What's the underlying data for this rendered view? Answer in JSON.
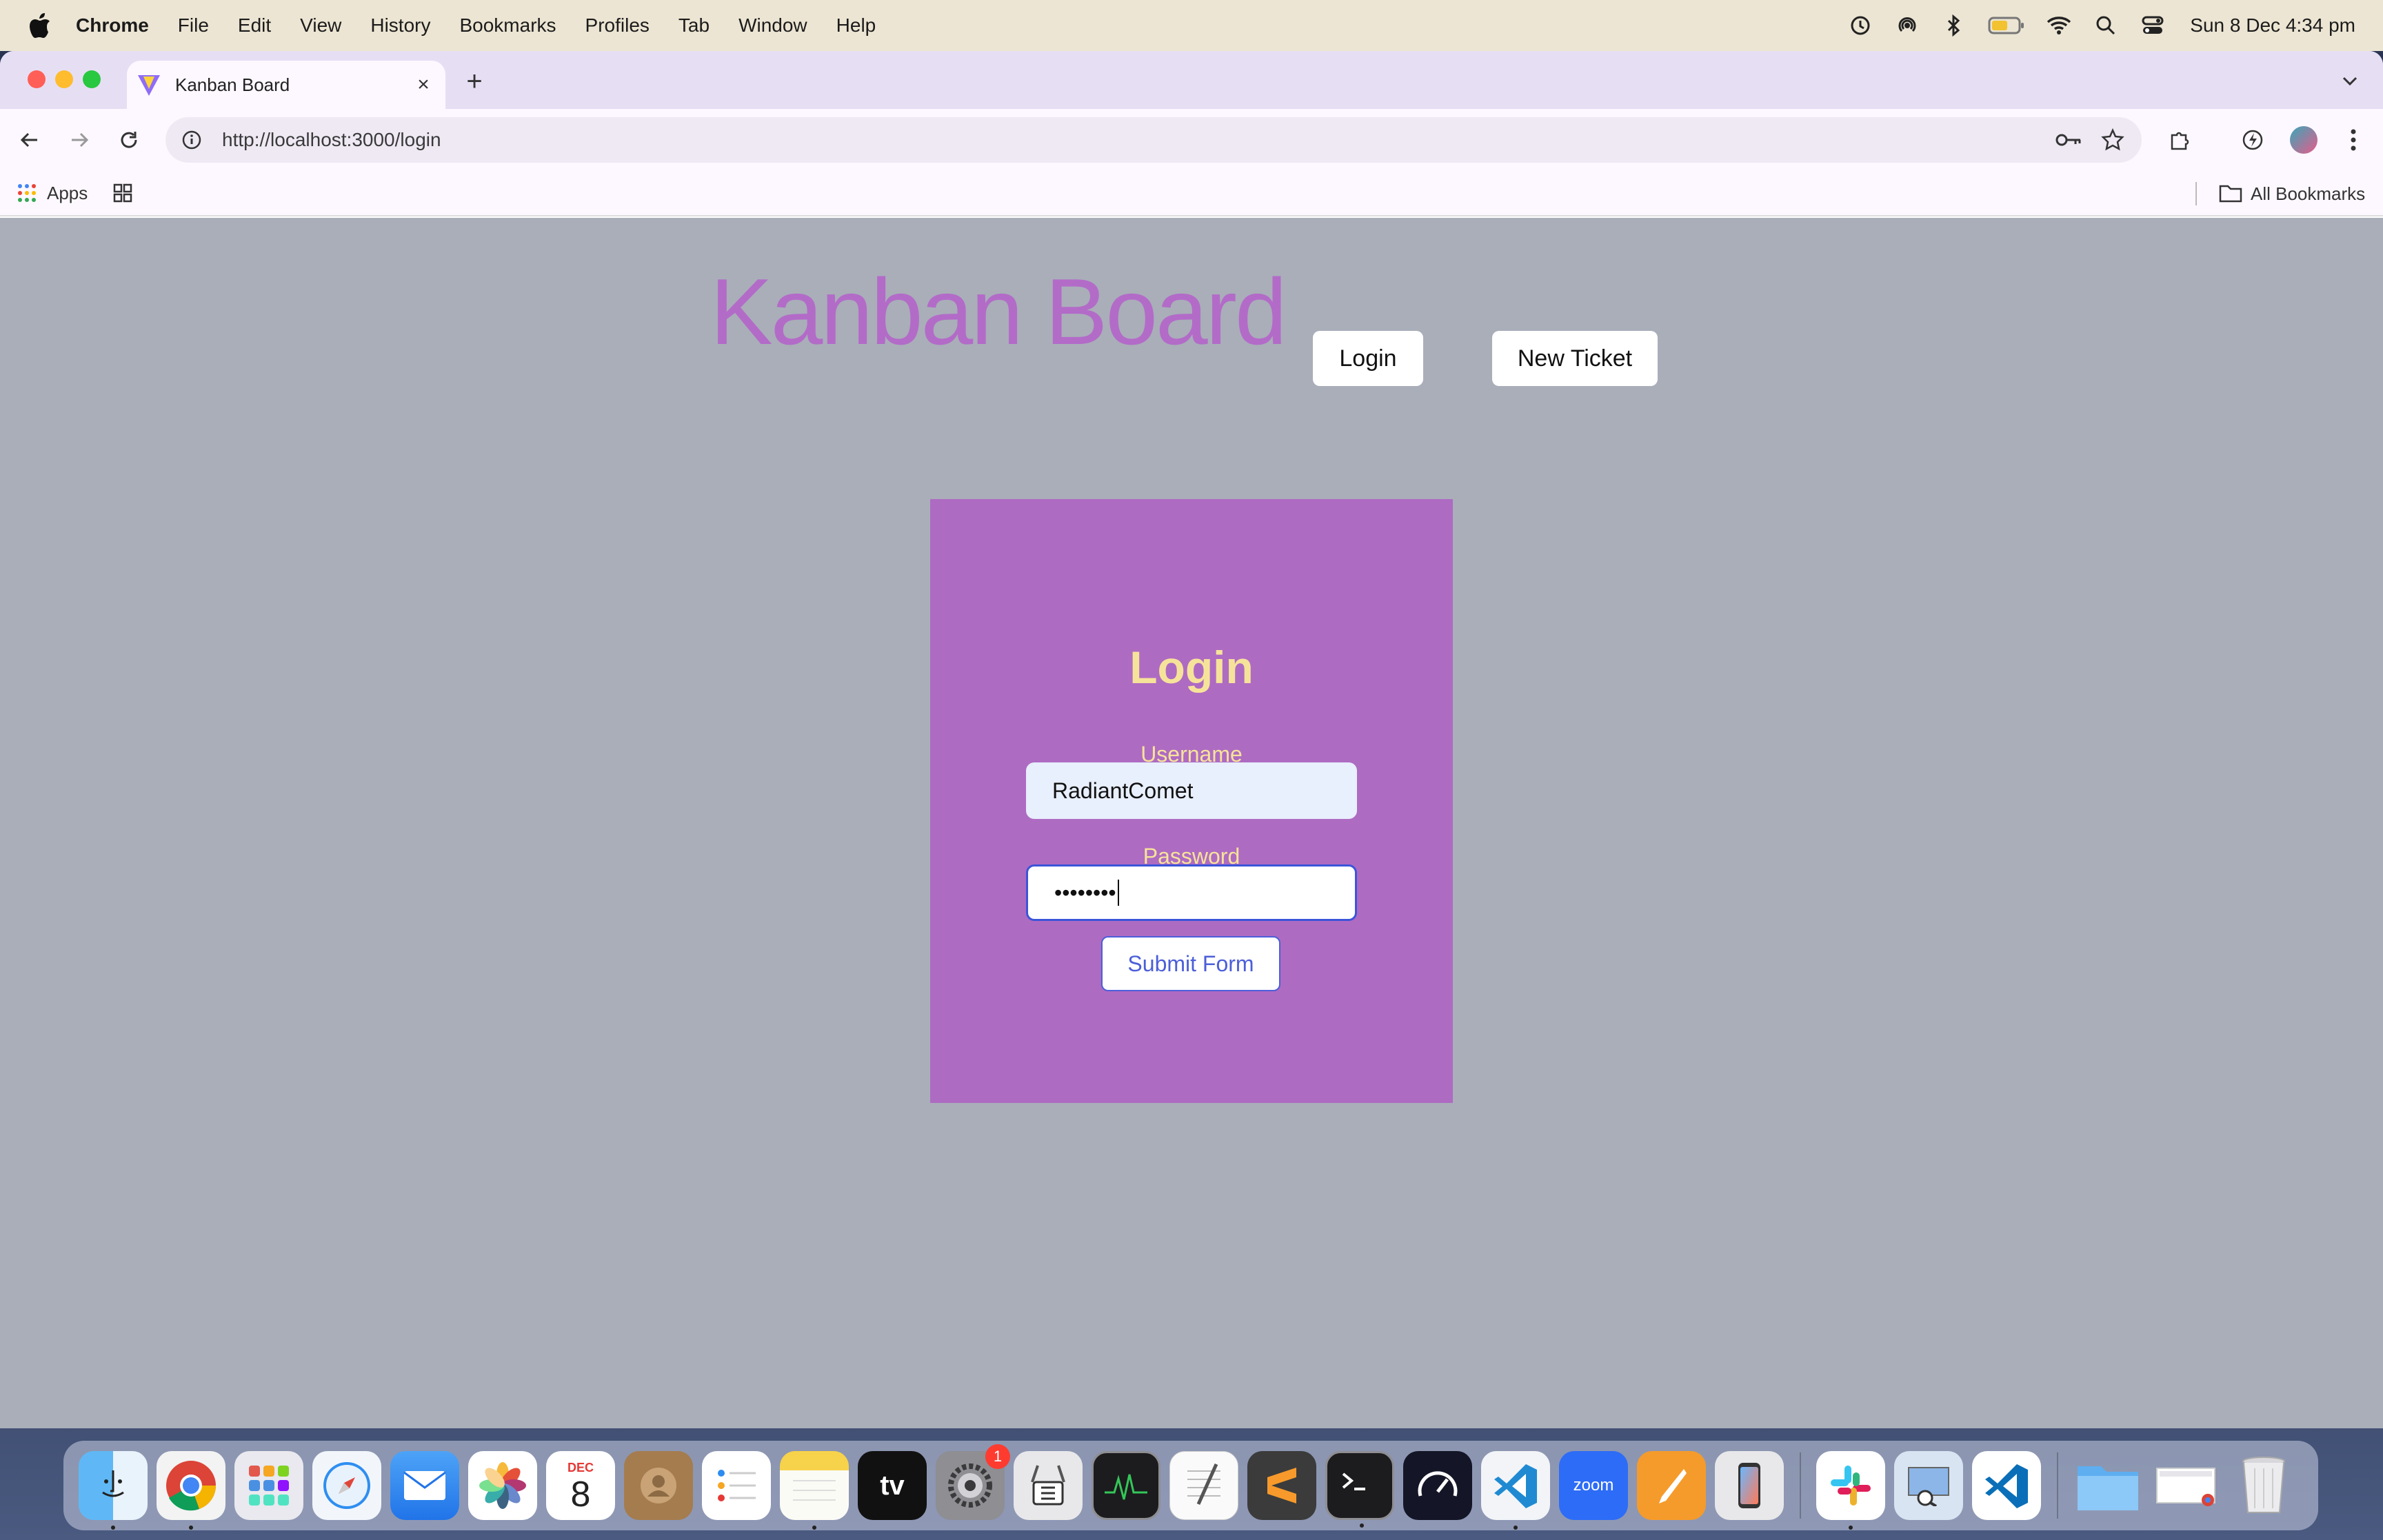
{
  "menubar": {
    "app_name": "Chrome",
    "items": [
      "File",
      "Edit",
      "View",
      "History",
      "Bookmarks",
      "Profiles",
      "Tab",
      "Window",
      "Help"
    ],
    "clock": "Sun 8 Dec  4:34 pm"
  },
  "browser": {
    "tab_title": "Kanban Board",
    "url": "http://localhost:3000/login",
    "bookmarks": {
      "apps_label": "Apps",
      "all_bookmarks_label": "All Bookmarks"
    }
  },
  "page": {
    "app_title": "Kanban Board",
    "nav": {
      "login_label": "Login",
      "new_ticket_label": "New Ticket"
    },
    "login_form": {
      "heading": "Login",
      "username_label": "Username",
      "username_value": "RadiantComet",
      "password_label": "Password",
      "password_masked": "••••••••",
      "submit_label": "Submit Form"
    }
  },
  "dock": {
    "apps": [
      "Finder",
      "Chrome",
      "Launchpad",
      "Safari",
      "Mail",
      "Photos",
      "Calendar",
      "Contacts",
      "Reminders",
      "Notes",
      "TV",
      "System Settings",
      "Archive Utility",
      "Activity Monitor",
      "TextEdit",
      "Sublime Text",
      "Terminal",
      "Speedtest",
      "VS Code",
      "Zoom",
      "Pages",
      "Simulator",
      "Slack",
      "Preview",
      "VS Code Insiders",
      "Downloads",
      "Screenshot",
      "Trash"
    ],
    "calendar_month": "DEC",
    "calendar_day": "8",
    "tv_label": "tv",
    "zoom_label": "zoom",
    "settings_badge": "1"
  },
  "colors": {
    "page_bg": "#a9aeb9",
    "title_purple": "#b36bc8",
    "card_purple": "#ae6bc2",
    "label_yellow": "#f6e39a",
    "accent_blue": "#4b5fd8"
  }
}
